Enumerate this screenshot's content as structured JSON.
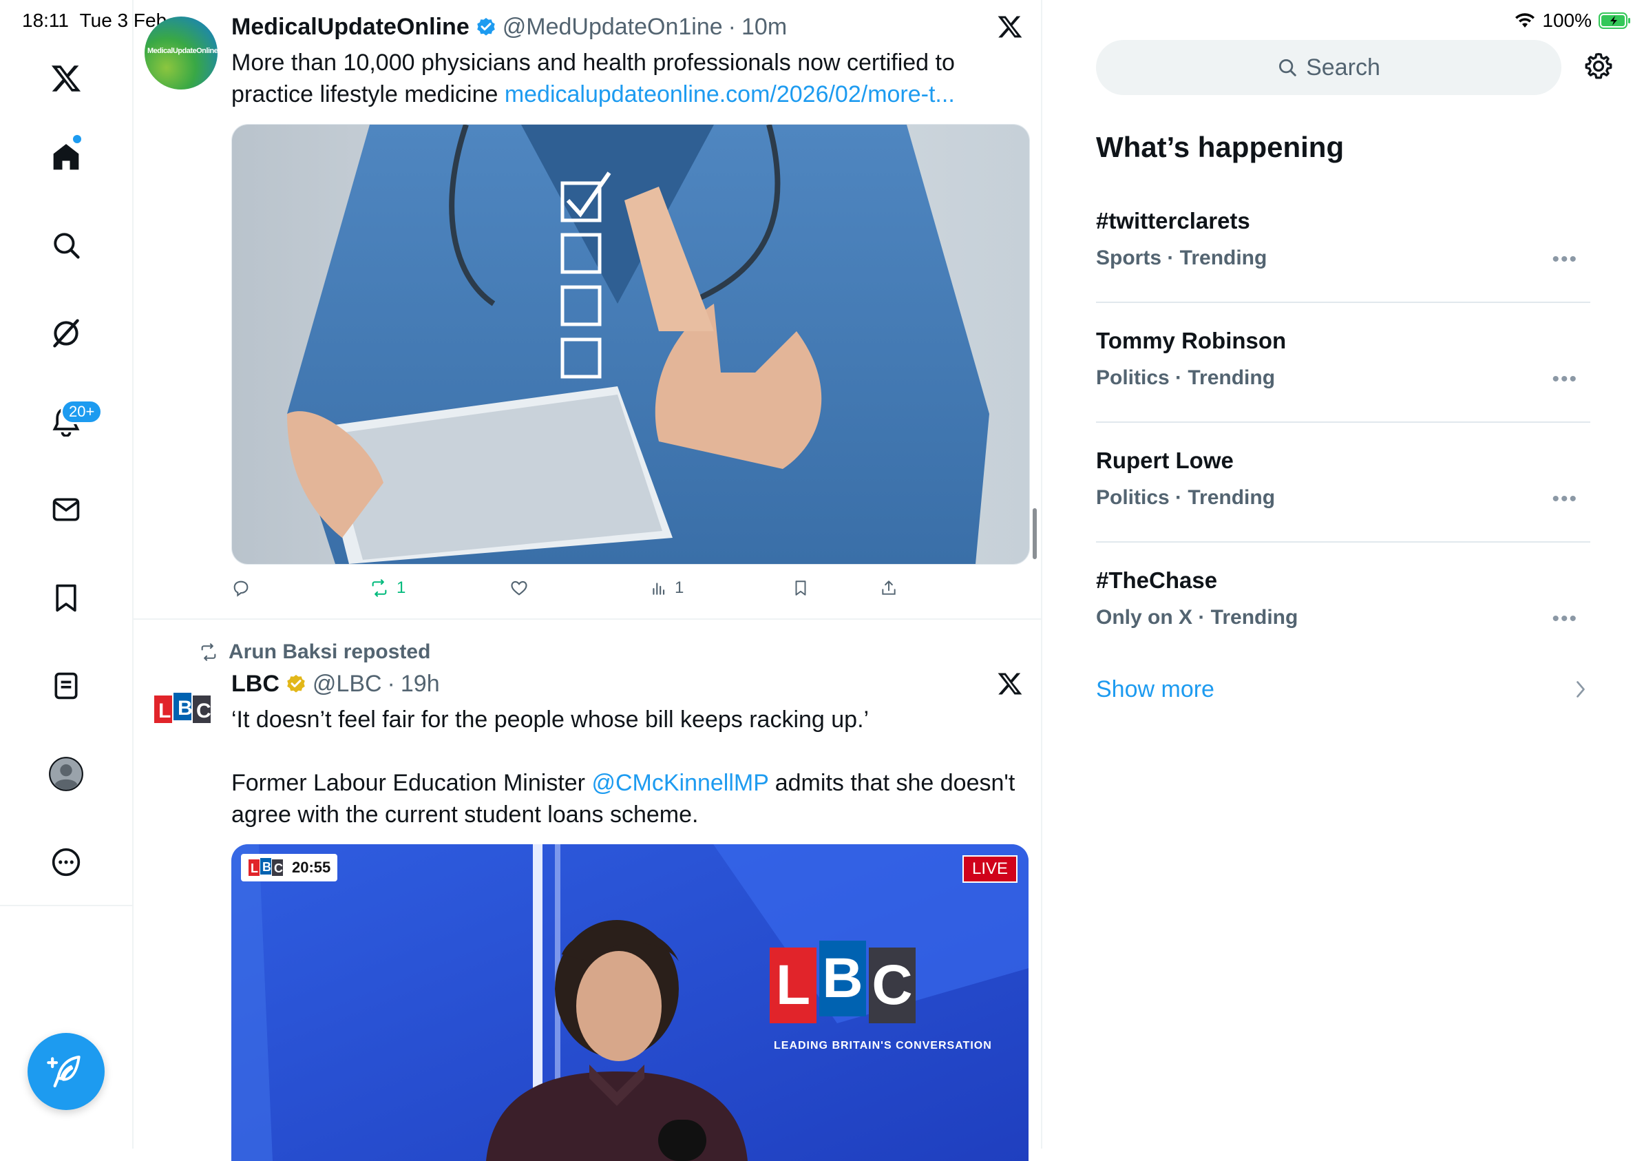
{
  "status_bar": {
    "time": "18:11",
    "date": "Tue 3 Feb",
    "battery": "100%"
  },
  "nav": {
    "notifications_badge": "20+",
    "items": [
      "x-logo-icon",
      "home-icon",
      "search-icon",
      "grok-icon",
      "notifications-icon",
      "messages-icon",
      "bookmarks-icon",
      "lists-icon",
      "profile-icon",
      "more-icon"
    ]
  },
  "feed": {
    "tweets": [
      {
        "name": "MedicalUpdateOnline",
        "handle": "@MedUpdateOn1ine",
        "time": "10m",
        "avatar_text": "MedicalUpdateOnline",
        "text": "More than 10,000 physicians and health professionals now certified to practice lifestyle medicine ",
        "link": "medicalupdateonline.com/2026/02/more-t...",
        "retweets": "1",
        "views": "1"
      },
      {
        "repost_by": "Arun Baksi reposted",
        "name": "LBC",
        "handle": "@LBC",
        "time": "19h",
        "text_line1": "‘It doesn’t feel fair for the people whose bill keeps racking up.’",
        "text_part2_pre": "Former Labour Education Minister ",
        "mention": "@CMcKinnellMP",
        "text_part2_post": " admits that she doesn't agree with the current student loans scheme.",
        "video_time": "20:55",
        "live_label": "LIVE",
        "logo_text": "LBC",
        "tagline": "LEADING BRITAIN'S CONVERSATION"
      }
    ]
  },
  "sidebar": {
    "search_placeholder": "Search",
    "section_title": "What’s happening",
    "trends": [
      {
        "name": "#twitterclarets",
        "meta": "Sports · Trending"
      },
      {
        "name": "Tommy Robinson",
        "meta": "Politics · Trending"
      },
      {
        "name": "Rupert Lowe",
        "meta": "Politics · Trending"
      },
      {
        "name": "#TheChase",
        "meta": "Only on X · Trending"
      }
    ],
    "show_more": "Show more"
  },
  "colors": {
    "accent": "#1d9bf0",
    "retweet_green": "#00ba7c",
    "text_secondary": "#536471",
    "verified_gold": "#e2b719",
    "live_red": "#d0021b"
  }
}
